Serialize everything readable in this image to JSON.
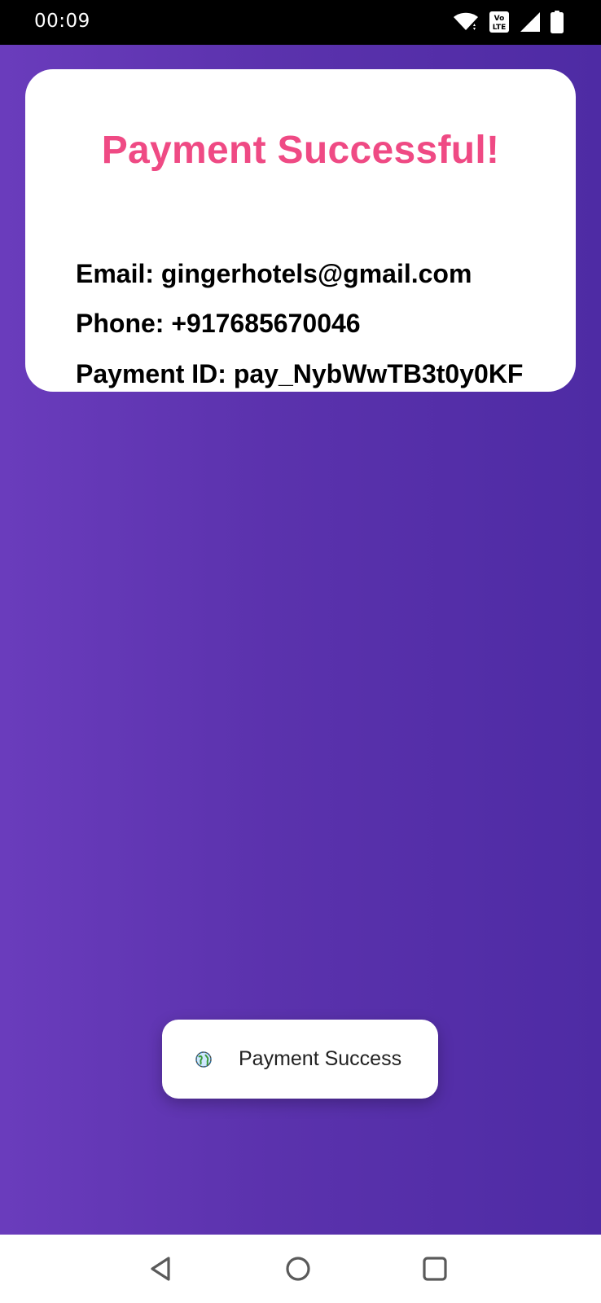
{
  "status_bar": {
    "time": "00:09",
    "icons": [
      "wifi-icon",
      "volte-icon",
      "signal-icon",
      "battery-icon"
    ],
    "volte_label_top": "Vo",
    "volte_label_bottom": "LTE"
  },
  "card": {
    "title": "Payment Successful!",
    "email_line": "Email: gingerhotels@gmail.com",
    "phone_line": "Phone: +917685670046",
    "payment_id_line": "Payment ID: pay_NybWwTB3t0y0KF"
  },
  "toast": {
    "icon": "app-globe-icon",
    "message": "Payment Success"
  },
  "nav_bar": {
    "buttons": [
      "back-icon",
      "home-icon",
      "recents-icon"
    ]
  },
  "colors": {
    "accent_title": "#ef4a84",
    "background_gradient_start": "#6a3cbc",
    "background_gradient_end": "#4e2ba4",
    "card_background": "#ffffff"
  }
}
